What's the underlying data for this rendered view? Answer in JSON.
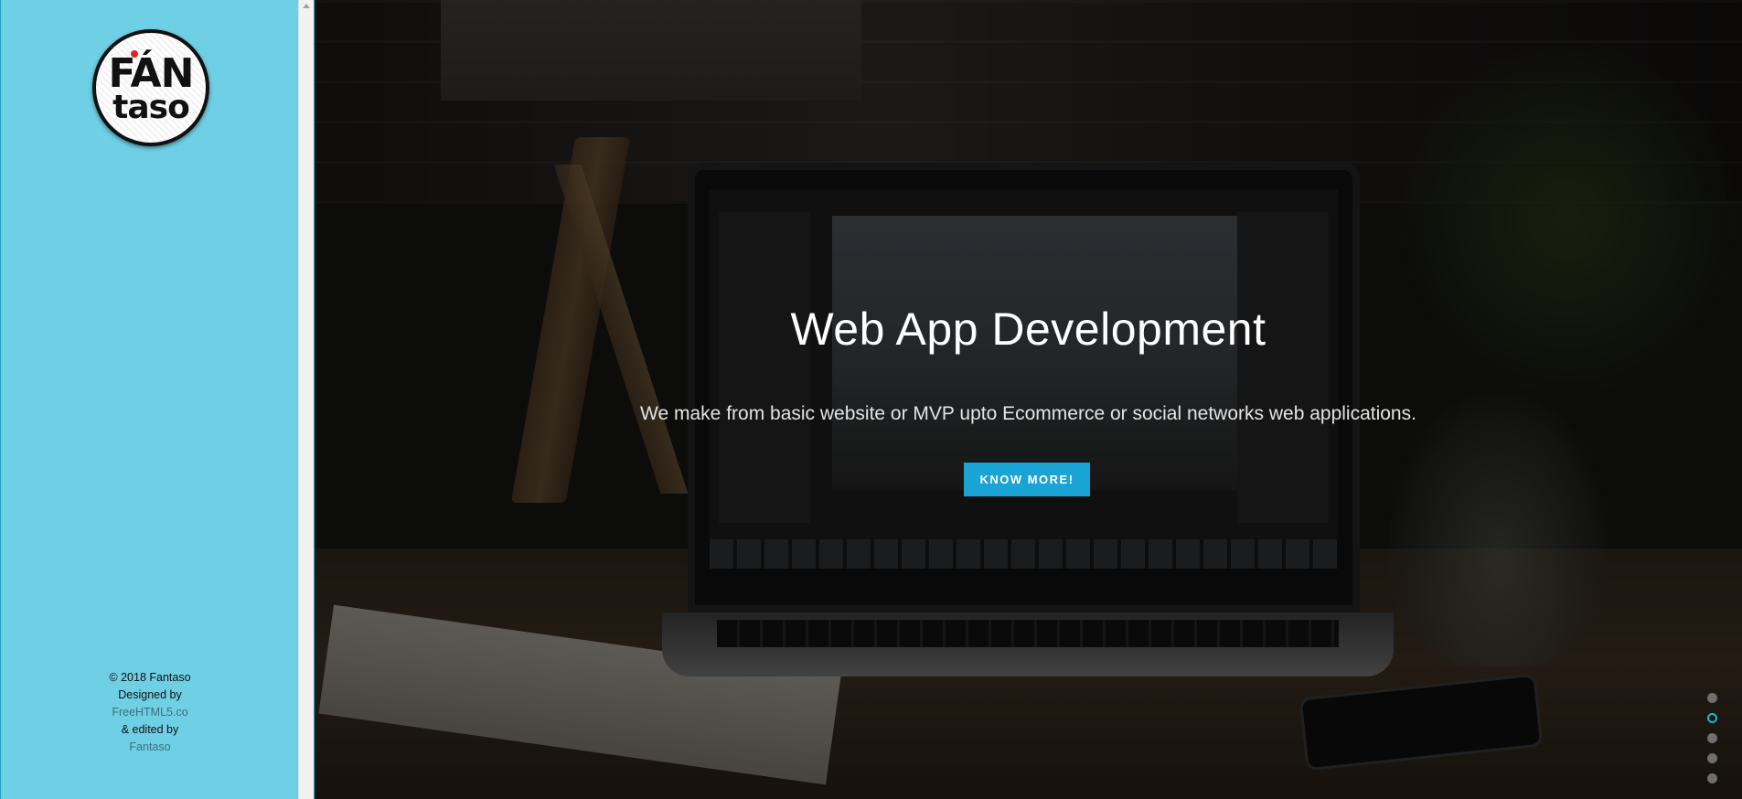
{
  "logo": {
    "top_text": "FÁN",
    "bottom_text": "taso"
  },
  "footer": {
    "copyright": "© 2018 Fantaso",
    "designed_by": "Designed by",
    "designer_link": "FreeHTML5.co",
    "edited_by": "& edited by",
    "editor_link": "Fantaso"
  },
  "hero": {
    "title": "Web App Development",
    "subtitle": "We make from basic website or MVP upto Ecommerce or social networks web applications.",
    "cta_label": "KNOW MORE!"
  },
  "slider": {
    "count": 5,
    "active_index": 1
  },
  "colors": {
    "sidebar_bg": "#6fcfe4",
    "accent": "#1aa3d5"
  }
}
